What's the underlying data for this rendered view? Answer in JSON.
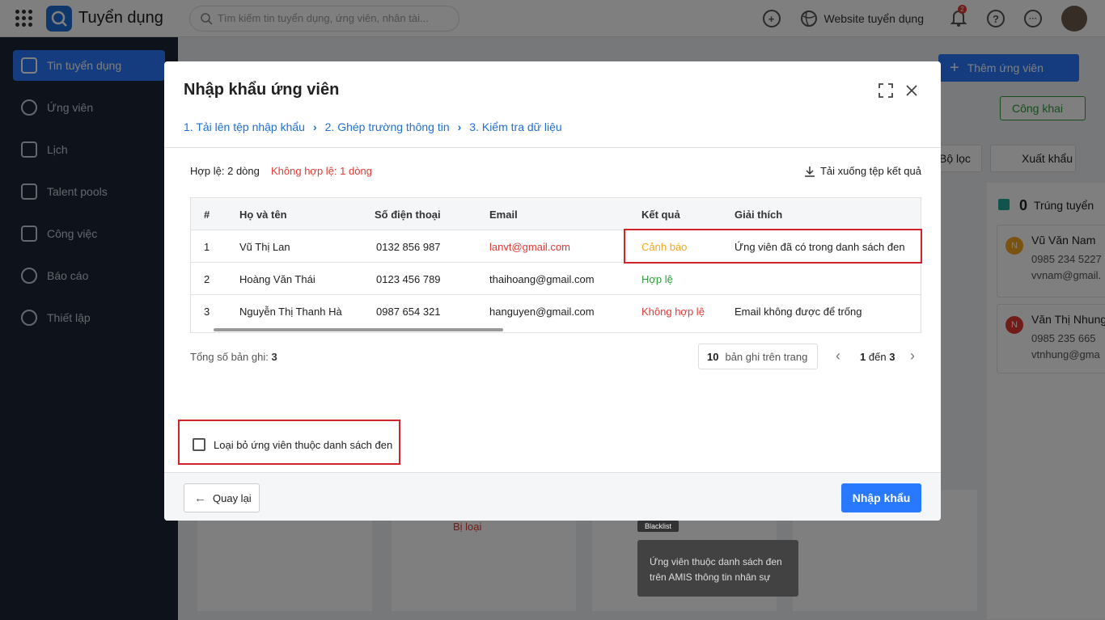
{
  "topbar": {
    "app_title": "Tuyển dụng",
    "search_placeholder": "Tìm kiếm tin tuyển dụng, ứng viên, nhân tài...",
    "website_link": "Website tuyển dụng",
    "notification_count": "2"
  },
  "sidebar": {
    "items": [
      {
        "label": "Tin tuyển dụng",
        "icon": "document-icon"
      },
      {
        "label": "Ứng viên",
        "icon": "users-icon"
      },
      {
        "label": "Lịch",
        "icon": "calendar-icon"
      },
      {
        "label": "Talent pools",
        "icon": "talent-icon"
      },
      {
        "label": "Công việc",
        "icon": "task-icon"
      },
      {
        "label": "Báo cáo",
        "icon": "chart-icon"
      },
      {
        "label": "Thiết lập",
        "icon": "gear-icon"
      }
    ]
  },
  "background": {
    "add_candidate": "Thêm ứng viên",
    "public_label": "Công khai",
    "filter": "Bộ lọc",
    "export": "Xuất khẩu",
    "hired_count": "0",
    "hired_label": "Trúng tuyển",
    "card1_name": "Vũ Văn Nam",
    "card1_phone": "0985 234 5227",
    "card1_email": "vvnam@gmail.",
    "card2_name": "Văn Thị Nhung",
    "card2_phone": "0985 235 665",
    "card2_email": "vtnhung@gma",
    "rejected": "Bị loại"
  },
  "modal": {
    "title": "Nhập khẩu ứng viên",
    "steps": [
      "1. Tải lên tệp nhập khẩu",
      "2. Ghép trường thông tin",
      "3. Kiểm tra dữ liệu"
    ],
    "valid_summary": "Hợp lệ: 2 dòng",
    "invalid_summary": "Không hợp lệ: 1 dòng",
    "download_label": "Tải xuống tệp kết quả",
    "columns": [
      "#",
      "Họ và tên",
      "Số điện thoại",
      "Email",
      "Kết quả",
      "Giải thích"
    ],
    "rows": [
      {
        "no": "1",
        "name": "Vũ Thị Lan",
        "phone": "0132 856 987",
        "email": "lanvt@gmail.com",
        "result": "Cảnh báo",
        "explain": "Ứng viên đã có trong danh sách đen"
      },
      {
        "no": "2",
        "name": "Hoàng Văn Thái",
        "phone": "0123 456 789",
        "email": "thaihoang@gmail.com",
        "result": "Hợp lệ",
        "explain": ""
      },
      {
        "no": "3",
        "name": "Nguyễn Thị Thanh Hà",
        "phone": "0987 654 321",
        "email": "hanguyen@gmail.com",
        "result": "Không hợp lệ",
        "explain": "Email không được để trống"
      }
    ],
    "total_label": "Tổng số bản ghi:",
    "total_value": "3",
    "page_size": "10",
    "page_size_label": "bản ghi trên trang",
    "page_from": "1",
    "page_to_label": "đến",
    "page_to": "3",
    "checkbox_label": "Loại bỏ ứng viên thuộc danh sách đen",
    "back_label": "Quay lại",
    "import_label": "Nhập khẩu"
  },
  "tooltip": {
    "tag": "Blacklist",
    "line1": "Ứng viên thuộc danh sách đen",
    "line2": "trên AMIS thông tin nhân sự"
  },
  "colors": {
    "accent": "#2979ff",
    "warning": "#f5a623",
    "valid": "#2e9d3a",
    "invalid": "#e53935",
    "highlight": "#d3232a"
  }
}
